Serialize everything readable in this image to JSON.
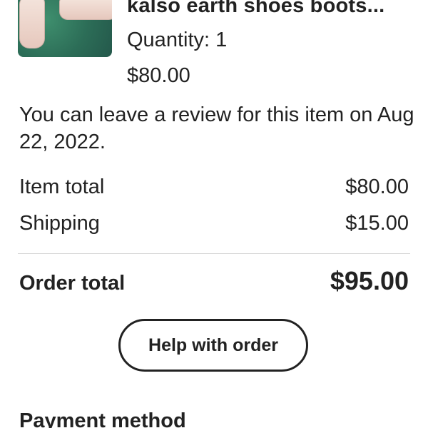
{
  "order_item": {
    "title": "kalso earth shoes boots...",
    "quantity": "Quantity: 1",
    "price": "$80.00"
  },
  "review_note": "You can leave a review for this item on Aug 22, 2022.",
  "summary": {
    "item_total": {
      "label": "Item total",
      "amount": "$80.00"
    },
    "shipping": {
      "label": "Shipping",
      "amount": "$15.00"
    },
    "order_total": {
      "label": "Order total",
      "amount": "$95.00"
    }
  },
  "help_button": {
    "label": "Help with order"
  },
  "payment": {
    "heading": "Payment method"
  }
}
